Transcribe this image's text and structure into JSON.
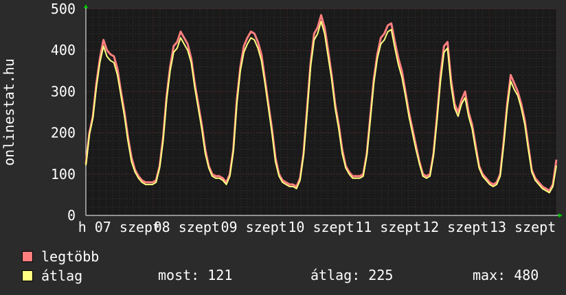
{
  "chart_data": {
    "type": "line",
    "ylabel": "onlinestat.hu",
    "ylim": [
      0,
      500
    ],
    "yticks": [
      0,
      100,
      200,
      300,
      400,
      500
    ],
    "x_tick_labels": [
      "h 07 szept",
      "08 szept",
      "09 szept",
      "10 szept",
      "11 szept",
      "12 szept",
      "13 szept"
    ],
    "grid": true,
    "series": [
      {
        "name": "legtöbb",
        "color": "#ff7f7f",
        "values": [
          125,
          200,
          240,
          320,
          380,
          425,
          400,
          390,
          385,
          355,
          300,
          250,
          190,
          140,
          110,
          95,
          85,
          80,
          80,
          80,
          85,
          120,
          190,
          290,
          360,
          410,
          420,
          445,
          430,
          415,
          380,
          320,
          270,
          220,
          160,
          120,
          100,
          95,
          95,
          90,
          80,
          100,
          160,
          280,
          360,
          410,
          430,
          445,
          440,
          420,
          390,
          330,
          270,
          210,
          140,
          100,
          85,
          80,
          75,
          75,
          70,
          90,
          150,
          260,
          370,
          440,
          455,
          485,
          455,
          400,
          340,
          270,
          220,
          160,
          120,
          105,
          95,
          95,
          95,
          100,
          150,
          240,
          330,
          390,
          430,
          440,
          460,
          465,
          420,
          380,
          350,
          300,
          250,
          210,
          170,
          130,
          100,
          95,
          100,
          150,
          240,
          340,
          410,
          420,
          330,
          270,
          250,
          280,
          300,
          250,
          220,
          170,
          120,
          100,
          90,
          80,
          75,
          80,
          100,
          180,
          270,
          340,
          320,
          300,
          270,
          230,
          170,
          110,
          90,
          80,
          70,
          65,
          60,
          75,
          135
        ]
      },
      {
        "name": "átlag",
        "color": "#ffff80",
        "values": [
          121,
          195,
          235,
          310,
          370,
          410,
          385,
          375,
          370,
          340,
          290,
          240,
          180,
          130,
          105,
          90,
          80,
          75,
          75,
          75,
          80,
          115,
          180,
          280,
          350,
          395,
          405,
          430,
          415,
          400,
          370,
          310,
          260,
          210,
          150,
          115,
          95,
          90,
          90,
          85,
          75,
          95,
          155,
          270,
          350,
          395,
          415,
          430,
          425,
          405,
          375,
          320,
          260,
          200,
          130,
          95,
          80,
          75,
          70,
          70,
          65,
          85,
          145,
          250,
          360,
          425,
          440,
          470,
          440,
          385,
          330,
          260,
          210,
          150,
          115,
          100,
          90,
          90,
          90,
          95,
          145,
          230,
          320,
          380,
          415,
          425,
          445,
          450,
          405,
          365,
          335,
          290,
          240,
          200,
          160,
          125,
          95,
          90,
          95,
          145,
          230,
          325,
          395,
          405,
          315,
          260,
          240,
          270,
          285,
          240,
          210,
          160,
          115,
          95,
          85,
          75,
          70,
          75,
          95,
          170,
          260,
          325,
          305,
          290,
          260,
          220,
          160,
          105,
          85,
          75,
          65,
          60,
          55,
          70,
          121
        ]
      }
    ]
  },
  "legend": [
    {
      "label": "legtöbb",
      "color": "#ff7f7f"
    },
    {
      "label": "átlag",
      "color": "#ffff80"
    }
  ],
  "stats": {
    "most": "most: 121",
    "atlag": "átlag: 225",
    "max": "max: 480"
  }
}
